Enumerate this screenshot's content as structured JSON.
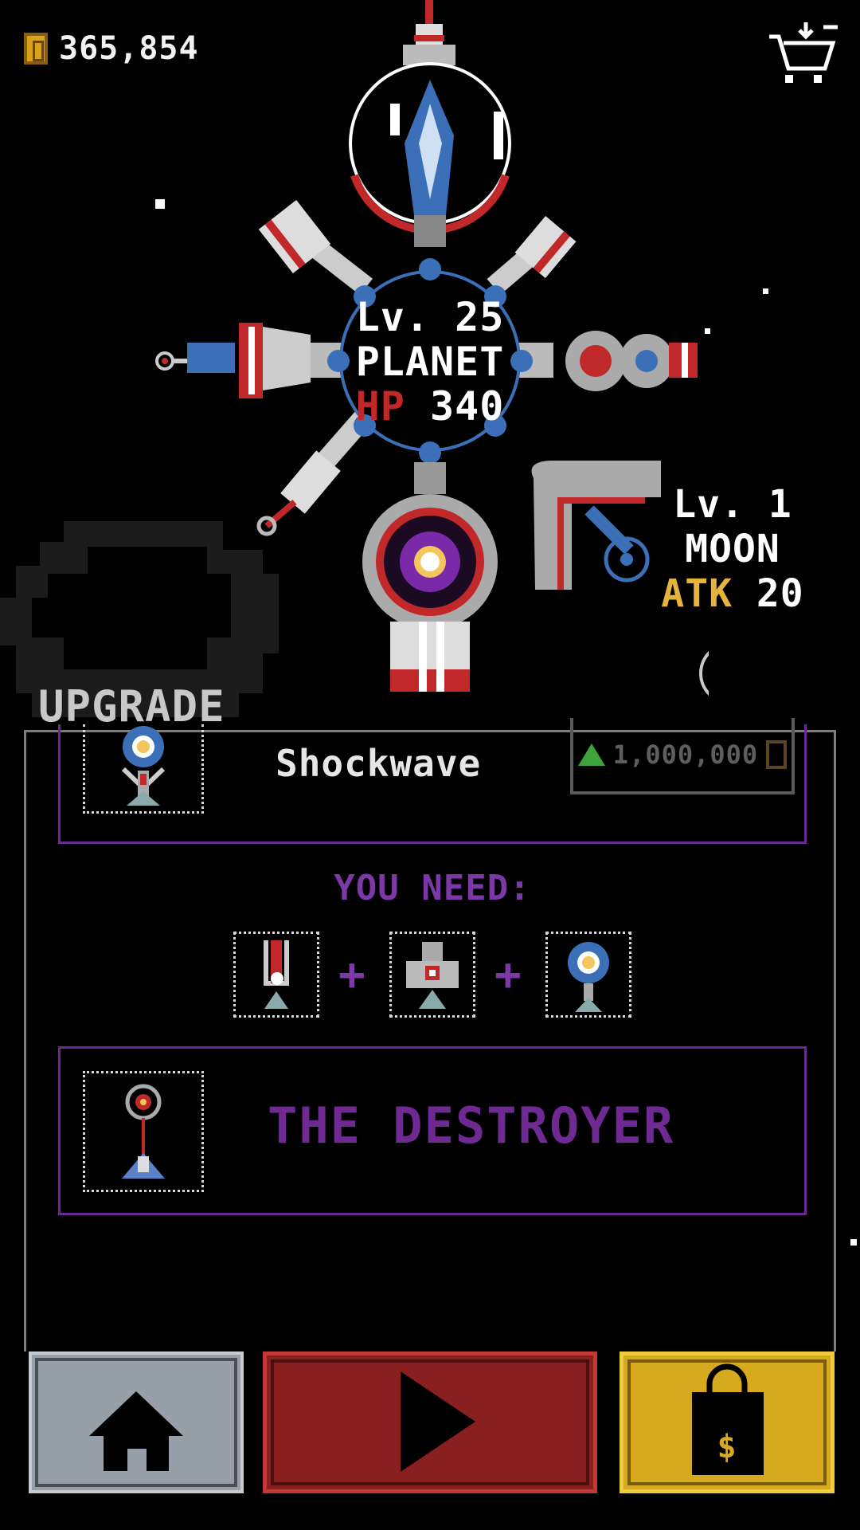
{
  "currency": {
    "coins": "365,854",
    "icon": "coin-icon"
  },
  "header": {
    "cart_icon": "cart-icon"
  },
  "planet": {
    "level": "Lv. 25",
    "name": "PLANET",
    "hp_label": "HP",
    "hp_value": "340"
  },
  "moon": {
    "level": "Lv. 1",
    "name": "MOON",
    "atk_label": "ATK",
    "atk_value": "20"
  },
  "upgrade": {
    "title": "UPGRADE",
    "current_item": {
      "name": "Shockwave",
      "price": "1,000,000",
      "icon": "shockwave-turret-icon"
    },
    "requirement_label": "YOU NEED:",
    "required_items": [
      "laser-turret-icon",
      "cannon-turret-icon",
      "shockwave-turret-icon"
    ],
    "result_item": {
      "name": "THE DESTROYER",
      "icon": "destroyer-turret-icon"
    }
  },
  "bottom_nav": {
    "home": "home-icon",
    "play": "play-icon",
    "shop": "shop-bag-icon",
    "shop_symbol": "$"
  },
  "colors": {
    "purple": "#6e2a92",
    "red_button": "#8a1f1f",
    "gold_button": "#d6a91e",
    "grey_button": "#97a0a8"
  }
}
